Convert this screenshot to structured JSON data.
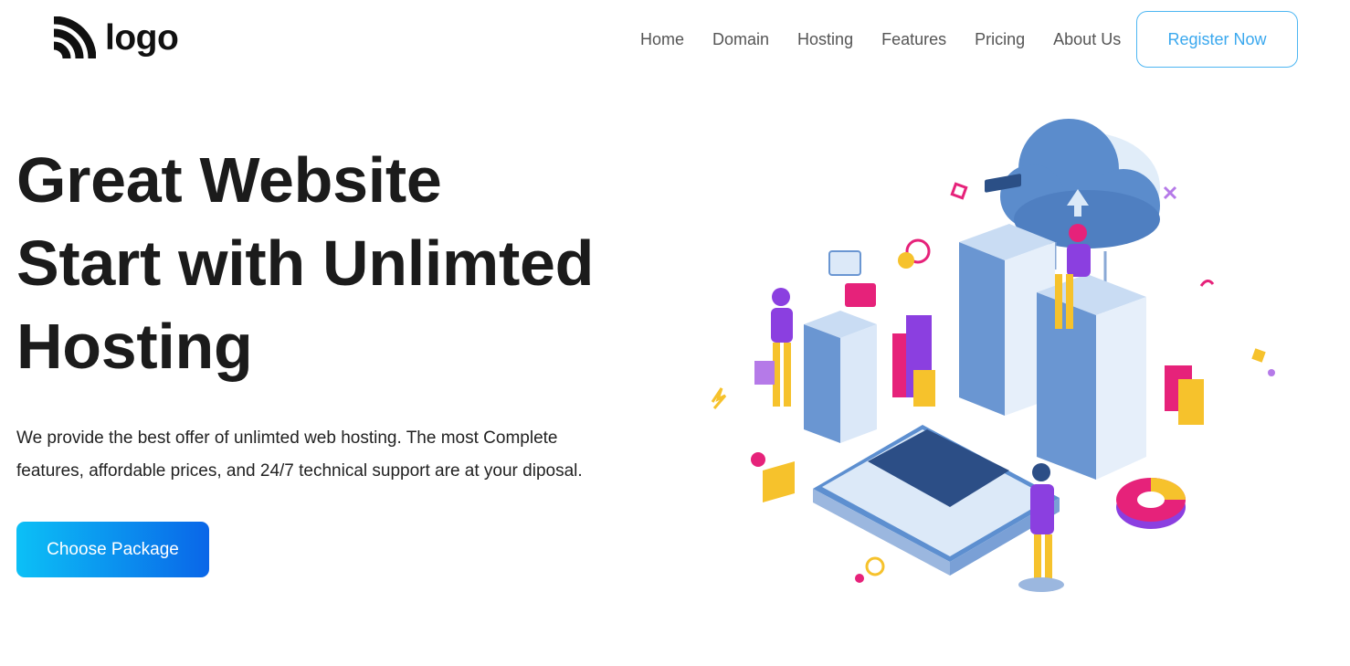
{
  "brand": {
    "logo_text": "logo",
    "logo_icon": "rss-feed-icon"
  },
  "nav": {
    "items": [
      {
        "label": "Home"
      },
      {
        "label": "Domain"
      },
      {
        "label": "Hosting"
      },
      {
        "label": "Features"
      },
      {
        "label": "Pricing"
      },
      {
        "label": "About Us"
      }
    ],
    "register_label": "Register Now"
  },
  "hero": {
    "title_lines": [
      "Great Website",
      "Start with Unlimted",
      "Hosting"
    ],
    "description_line1": "We provide the best offer of unlimted web hosting. The most Complete",
    "description_line2": "features, affordable prices, and 24/7 technical support are at your diposal.",
    "cta_label": "Choose Package",
    "illustration": "isometric-server-hosting-illustration"
  },
  "colors": {
    "accent": "#3aa8ee",
    "cta_start": "#0cc0f6",
    "cta_end": "#0a66e8",
    "server_blue": "#4f7fc1",
    "purple": "#8b3fe0",
    "pink": "#e6227a",
    "yellow": "#f6c22c"
  }
}
